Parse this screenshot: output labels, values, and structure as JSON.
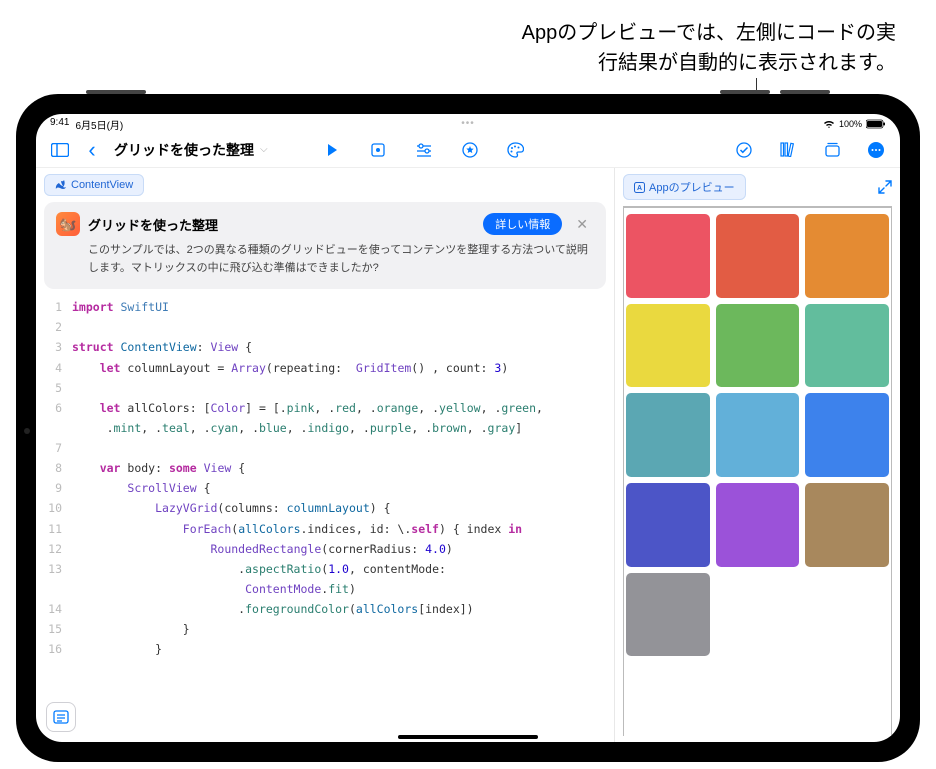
{
  "caption": {
    "line1": "Appのプレビューでは、左側にコードの実",
    "line2": "行結果が自動的に表示されます。"
  },
  "statusbar": {
    "time": "9:41",
    "date": "6月5日(月)",
    "battery": "100%"
  },
  "toolbar": {
    "back": "‹",
    "title": "グリッドを使った整理"
  },
  "chips": {
    "contentview": "ContentView"
  },
  "infocard": {
    "title": "グリッドを使った整理",
    "button": "詳しい情報",
    "body": "このサンプルでは、2つの異なる種類のグリッドビューを使ってコンテンツを整理する方法ついて説明します。マトリックスの中に飛び込む準備はできましたか?"
  },
  "code": {
    "l1": "import SwiftUI",
    "l3a": "struct",
    "l3b": "ContentView",
    "l3c": ": View {",
    "l4a": "    let",
    "l4b": "columnLayout = Array(repeating:  GridItem() , count:",
    "l4c": "3",
    "l4d": ")",
    "l6a": "    let",
    "l6b": "allColors: [Color] = [.pink, .red, .orange, .yellow, .green,",
    "l6c": "     .mint, .teal, .cyan, .blue, .indigo, .purple, .brown, .gray]",
    "l8a": "    var",
    "l8b": "body:",
    "l8c": "some",
    "l8d": "View {",
    "l9": "        ScrollView {",
    "l10a": "            LazyVGrid(columns:",
    "l10b": "columnLayout",
    "l10c": ") {",
    "l11a": "                ForEach(",
    "l11b": "allColors",
    "l11c": ".indices, id: \\.",
    "l11d": "self",
    "l11e": ") { index",
    "l11f": "in",
    "l12a": "                    RoundedRectangle(cornerRadius:",
    "l12b": "4.0",
    "l12c": ")",
    "l13a": "                        .aspectRatio(",
    "l13b": "1.0",
    "l13c": ", contentMode:",
    "l13d": "                         ContentMode.fit)",
    "l14a": "                        .foregroundColor(",
    "l14b": "allColors",
    "l14c": "[index])",
    "l15": "                }",
    "l16": "            }"
  },
  "preview": {
    "label": "Appのプレビュー",
    "colors": [
      "#ec5463",
      "#e25c44",
      "#e48b33",
      "#ead93f",
      "#6cb85c",
      "#62bd9d",
      "#5ba7b3",
      "#62b0d9",
      "#3d82ec",
      "#4c55c7",
      "#9b52d9",
      "#a8885d",
      "#939398"
    ]
  }
}
